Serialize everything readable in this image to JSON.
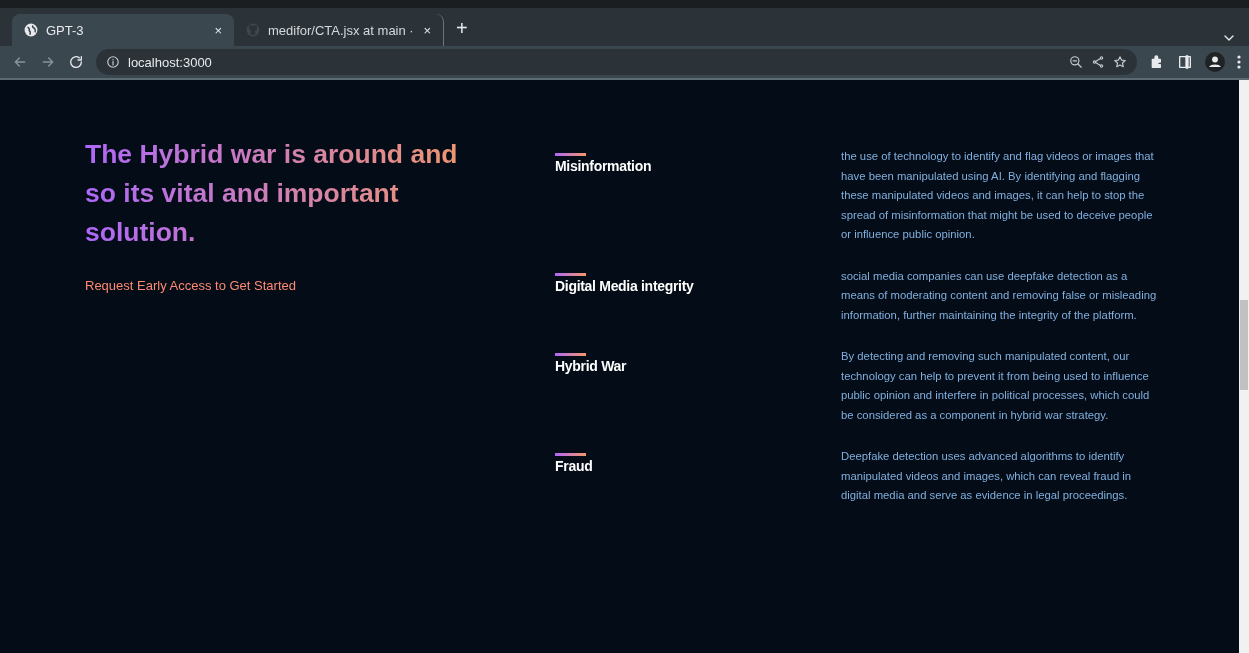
{
  "browser": {
    "tabs": [
      {
        "title": "GPT-3",
        "selected": true
      },
      {
        "title": "medifor/CTA.jsx at main ·",
        "selected": false
      }
    ],
    "close": "×",
    "new_tab": "+",
    "url": "localhost:3000"
  },
  "hero": {
    "heading": "The Hybrid war is around and so its vital and important solution.",
    "link": "Request Early Access to Get Started"
  },
  "features": [
    {
      "title": "Misinformation",
      "text": "the use of technology to identify and flag videos or images that have been manipulated using AI. By identifying and flagging these manipulated videos and images, it can help to stop the spread of misinformation that might be used to deceive people or influence public opinion."
    },
    {
      "title": "Digital Media integrity",
      "text": "social media companies can use deepfake detection as a means of moderating content and removing false or misleading information, further maintaining the integrity of the platform."
    },
    {
      "title": "Hybrid War",
      "text": "By detecting and removing such manipulated content, our technology can help to prevent it from being used to influence public opinion and interfere in political processes, which could be considered as a component in hybrid war strategy."
    },
    {
      "title": "Fraud",
      "text": "Deepfake detection uses advanced algorithms to identify manipulated videos and images, which can reveal fraud in digital media and serve as evidence in legal proceedings."
    }
  ]
}
